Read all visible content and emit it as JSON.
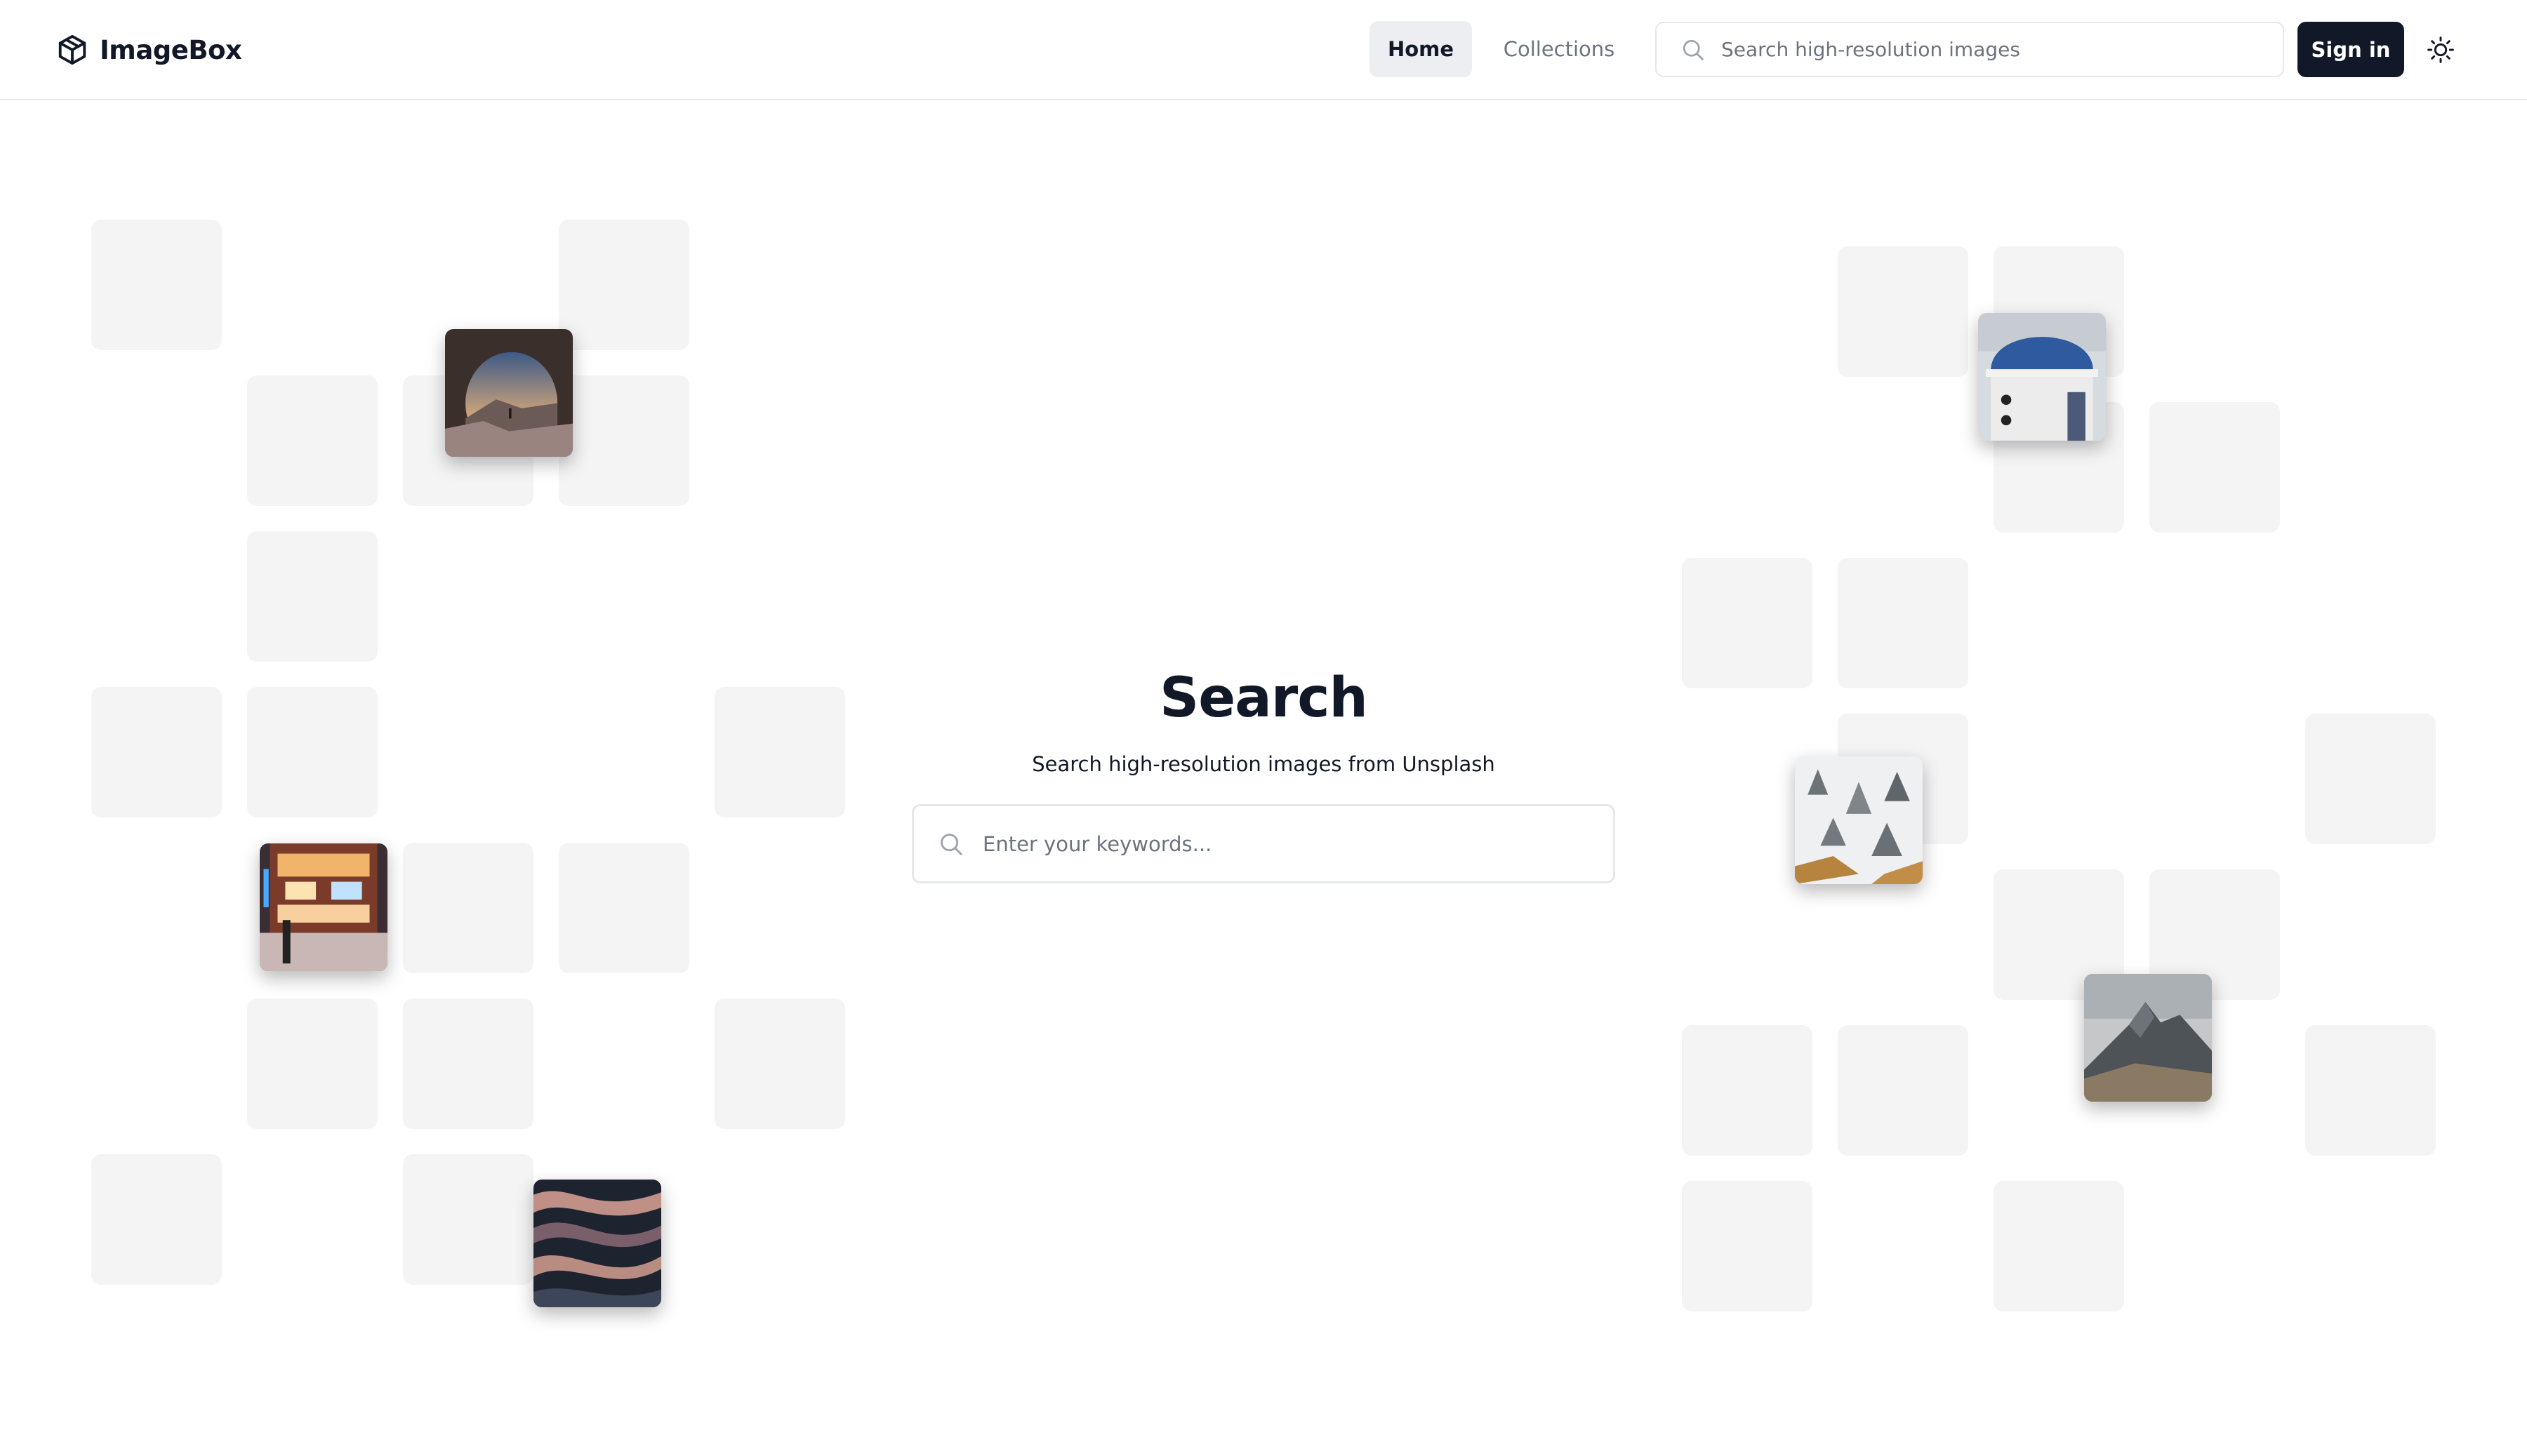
{
  "brand": {
    "name": "ImageBox",
    "logo_icon": "cube-icon"
  },
  "nav": {
    "items": [
      {
        "label": "Home",
        "active": true
      },
      {
        "label": "Collections",
        "active": false
      }
    ]
  },
  "header_search": {
    "placeholder": "Search high-resolution images",
    "value": "",
    "icon": "search-icon"
  },
  "signin_label": "Sign in",
  "theme_toggle": {
    "icon": "sun-icon"
  },
  "hero": {
    "title": "Search",
    "subtitle": "Search high-resolution images from Unsplash",
    "search": {
      "placeholder": "Enter your keywords...",
      "value": "",
      "icon": "search-icon"
    }
  },
  "gallery_photos": [
    {
      "name": "photo-rock-arch-sunset"
    },
    {
      "name": "photo-neon-city-street"
    },
    {
      "name": "photo-abstract-waves"
    },
    {
      "name": "photo-blue-dome-church"
    },
    {
      "name": "photo-snowy-forest"
    },
    {
      "name": "photo-rocky-mountain"
    }
  ],
  "colors": {
    "text": "#111827",
    "muted": "#6b7280",
    "nav_active_bg": "#eceef1",
    "button_bg": "#111827",
    "tile_bg": "#f4f4f5",
    "border": "#e5e7eb"
  }
}
